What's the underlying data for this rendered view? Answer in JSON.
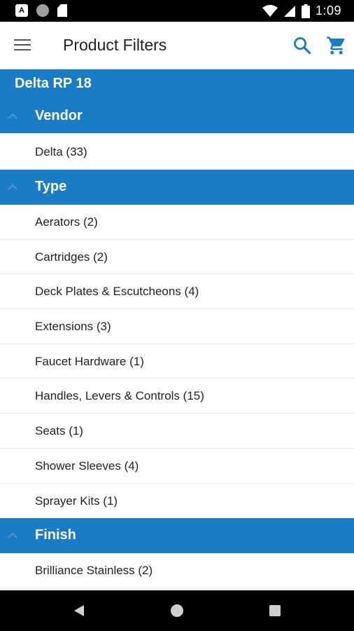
{
  "status_bar": {
    "time": "1:09",
    "left_icons": [
      "app-notification-icon",
      "circle-notification-icon",
      "sd-card-icon"
    ],
    "right_icons": [
      "wifi-icon",
      "cell-signal-icon",
      "battery-icon"
    ]
  },
  "app_bar": {
    "title": "Product Filters",
    "icons": [
      "menu-icon",
      "search-icon",
      "cart-icon"
    ]
  },
  "product": {
    "name": "Delta RP 18"
  },
  "sections": {
    "vendor": {
      "label": "Vendor",
      "items": [
        "Delta (33)"
      ]
    },
    "type": {
      "label": "Type",
      "items": [
        "Aerators (2)",
        "Cartridges (2)",
        "Deck Plates & Escutcheons (4)",
        "Extensions (3)",
        "Faucet Hardware (1)",
        "Handles, Levers & Controls (15)",
        "Seats (1)",
        "Shower Sleeves (4)",
        "Sprayer Kits (1)"
      ]
    },
    "finish": {
      "label": "Finish",
      "items": [
        "Brilliance Stainless (2)"
      ]
    }
  },
  "nav_bar": {
    "icons": [
      "back-icon",
      "home-icon",
      "recent-apps-icon"
    ]
  },
  "colors": {
    "accent": "#1b7cc6",
    "status_bar": "#000000",
    "nav_bar": "#000000"
  }
}
